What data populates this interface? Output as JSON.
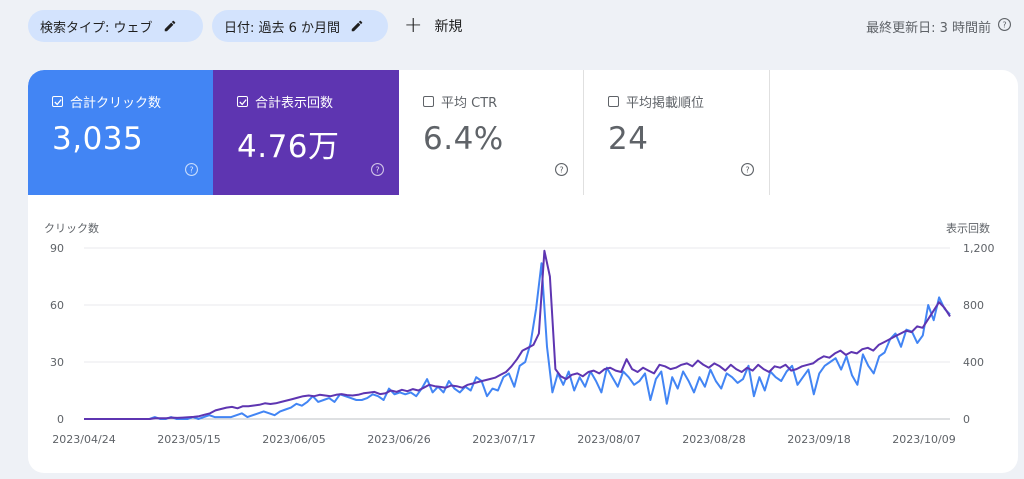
{
  "filters": {
    "search_type": "検索タイプ: ウェブ",
    "date": "日付: 過去 6 か月間",
    "new_label": "新規"
  },
  "last_updated": "最終更新日: 3 時間前",
  "metrics": {
    "clicks": {
      "label": "合計クリック数",
      "value": "3,035",
      "checked": true,
      "color": "#4285f4"
    },
    "impressions": {
      "label": "合計表示回数",
      "value": "4.76万",
      "checked": true,
      "color": "#5e35b1"
    },
    "ctr": {
      "label": "平均 CTR",
      "value": "6.4%",
      "checked": false
    },
    "position": {
      "label": "平均掲載順位",
      "value": "24",
      "checked": false
    }
  },
  "chart_data": {
    "type": "line",
    "ylabel_left": "クリック数",
    "ylabel_right": "表示回数",
    "ylim_left": [
      0,
      90
    ],
    "ylim_right": [
      0,
      1200
    ],
    "yticks_left": [
      "0",
      "30",
      "60",
      "90"
    ],
    "yticks_right": [
      "0",
      "400",
      "800",
      "1,200"
    ],
    "xtick_labels": [
      "2023/04/24",
      "2023/05/15",
      "2023/06/05",
      "2023/06/26",
      "2023/07/17",
      "2023/08/07",
      "2023/08/28",
      "2023/09/18",
      "2023/10/09"
    ],
    "grid": true,
    "series": [
      {
        "name": "クリック数",
        "axis": "left",
        "color": "#4285f4",
        "values": [
          0,
          0,
          0,
          0,
          0,
          0,
          0,
          0,
          0,
          0,
          0,
          0,
          0,
          1,
          0,
          0,
          1,
          0,
          0,
          0,
          1,
          0,
          1,
          2,
          1,
          1,
          1,
          1,
          2,
          3,
          1,
          2,
          3,
          4,
          3,
          2,
          4,
          5,
          6,
          8,
          7,
          9,
          12,
          9,
          10,
          11,
          9,
          13,
          12,
          11,
          10,
          10,
          11,
          13,
          12,
          10,
          16,
          13,
          14,
          13,
          14,
          12,
          16,
          21,
          14,
          17,
          14,
          20,
          16,
          14,
          17,
          15,
          22,
          20,
          12,
          16,
          15,
          22,
          24,
          17,
          28,
          30,
          40,
          58,
          82,
          38,
          14,
          24,
          18,
          25,
          15,
          22,
          17,
          25,
          20,
          14,
          27,
          22,
          17,
          25,
          22,
          18,
          20,
          24,
          10,
          21,
          25,
          8,
          22,
          16,
          25,
          20,
          14,
          22,
          17,
          26,
          20,
          16,
          24,
          22,
          19,
          21,
          28,
          12,
          22,
          15,
          25,
          22,
          20,
          25,
          28,
          18,
          22,
          26,
          13,
          24,
          28,
          30,
          32,
          26,
          33,
          23,
          18,
          34,
          28,
          24,
          33,
          35,
          42,
          45,
          38,
          47,
          46,
          40,
          44,
          60,
          52,
          64,
          58,
          55
        ]
      },
      {
        "name": "表示回数",
        "axis": "right",
        "color": "#5e35b1",
        "values": [
          0,
          0,
          0,
          0,
          0,
          0,
          0,
          0,
          0,
          0,
          0,
          0,
          0,
          5,
          5,
          5,
          10,
          8,
          10,
          12,
          15,
          20,
          30,
          40,
          60,
          70,
          80,
          85,
          75,
          90,
          90,
          95,
          100,
          110,
          105,
          110,
          120,
          130,
          140,
          150,
          160,
          165,
          160,
          170,
          165,
          160,
          170,
          175,
          168,
          165,
          170,
          180,
          185,
          190,
          175,
          180,
          200,
          190,
          205,
          195,
          210,
          200,
          220,
          240,
          230,
          225,
          220,
          235,
          230,
          220,
          240,
          250,
          260,
          270,
          280,
          290,
          310,
          330,
          370,
          420,
          480,
          500,
          520,
          600,
          1180,
          1000,
          350,
          300,
          280,
          310,
          320,
          300,
          330,
          340,
          320,
          350,
          360,
          340,
          330,
          420,
          350,
          330,
          360,
          340,
          320,
          380,
          370,
          350,
          360,
          380,
          390,
          370,
          410,
          380,
          360,
          390,
          370,
          340,
          380,
          350,
          330,
          360,
          340,
          380,
          350,
          330,
          370,
          360,
          380,
          340,
          350,
          370,
          380,
          390,
          420,
          440,
          430,
          460,
          480,
          450,
          470,
          460,
          490,
          500,
          480,
          520,
          540,
          560,
          580,
          600,
          620,
          610,
          650,
          640,
          700,
          760,
          820,
          780,
          720
        ]
      }
    ]
  },
  "colors": {
    "bg": "#eef1f6",
    "chip": "#d3e3fd",
    "clicks": "#4285f4",
    "impressions": "#5e35b1"
  },
  "icons": {
    "pencil": "pencil-icon",
    "plus": "plus-icon",
    "help": "help-icon",
    "checkbox": "checkbox-icon"
  }
}
